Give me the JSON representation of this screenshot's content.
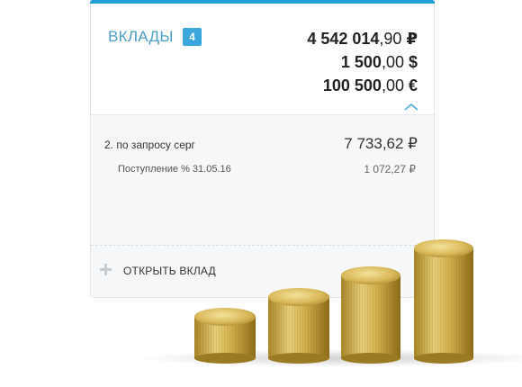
{
  "deposits": {
    "title": "ВКЛАДЫ",
    "count": "4",
    "totals": [
      {
        "int": "4 542 014",
        "dec": ",90",
        "cur": "₽"
      },
      {
        "int": "1 500",
        "dec": ",00",
        "cur": "$"
      },
      {
        "int": "100 500",
        "dec": ",00",
        "cur": "€"
      }
    ],
    "item": {
      "name": "2. по запросу серг",
      "amount": "7 733,62 ₽",
      "transaction": {
        "label": "Поступление % 31.05.16",
        "amount": "1 072,27 ₽"
      }
    },
    "open_label": "ОТКРЫТЬ ВКЛАД"
  },
  "colors": {
    "accent": "#1f9fd6",
    "badge": "#39a7dc",
    "title": "#4a9ec7",
    "coin": "#d4b24a"
  },
  "icons": {
    "collapse": "chevron-up-icon",
    "add": "plus-icon",
    "decor": "coin-stacks"
  }
}
